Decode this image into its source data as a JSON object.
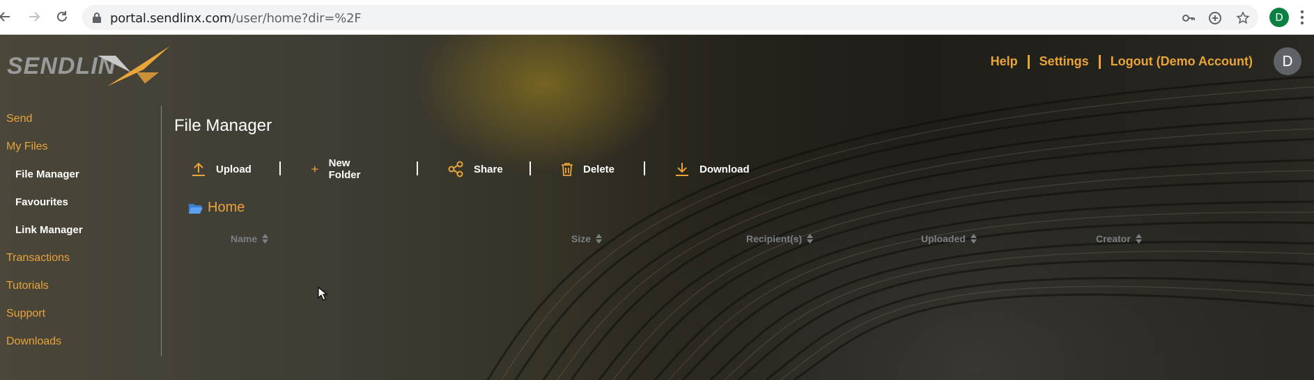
{
  "browser": {
    "url_host": "portal.sendlinx.com",
    "url_path": "/user/home?dir=%2F",
    "profile_initial": "D"
  },
  "brand": {
    "logo_text": "SENDLIN",
    "accent": "#e9a43a"
  },
  "header": {
    "links": [
      "Help",
      "Settings",
      "Logout (Demo Account)"
    ],
    "avatar_initial": "D"
  },
  "sidebar": {
    "items": [
      {
        "label": "Send"
      },
      {
        "label": "My Files"
      },
      {
        "label": "File Manager"
      },
      {
        "label": "Favourites"
      },
      {
        "label": "Link Manager"
      },
      {
        "label": "Transactions"
      },
      {
        "label": "Tutorials"
      },
      {
        "label": "Support"
      },
      {
        "label": "Downloads"
      }
    ]
  },
  "main": {
    "title": "File Manager",
    "toolbar": {
      "upload": "Upload",
      "new_folder": "New Folder",
      "share": "Share",
      "delete": "Delete",
      "download": "Download"
    },
    "breadcrumb": {
      "home": "Home"
    },
    "columns": [
      "Name",
      "Size",
      "Recipient(s)",
      "Uploaded",
      "Creator"
    ]
  }
}
